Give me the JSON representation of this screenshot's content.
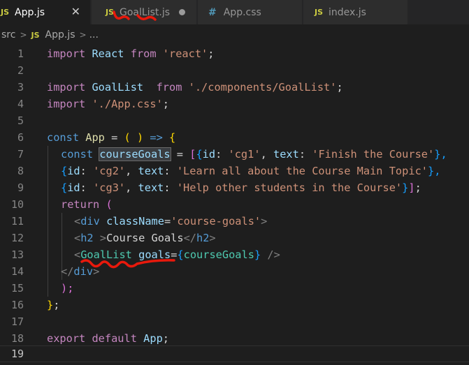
{
  "tabs": [
    {
      "icon": "JS",
      "label": "App.js",
      "close": "✕"
    },
    {
      "icon": "JS",
      "label": "GoalList.js"
    },
    {
      "icon": "#",
      "label": "App.css"
    },
    {
      "icon": "JS",
      "label": "index.js"
    }
  ],
  "breadcrumb": {
    "folder": "src",
    "sep": ">",
    "icon": "JS",
    "file": "App.js",
    "more": "..."
  },
  "editor": {
    "line_numbers": [
      "1",
      "2",
      "3",
      "4",
      "5",
      "6",
      "7",
      "8",
      "9",
      "10",
      "11",
      "12",
      "13",
      "14",
      "15",
      "16",
      "17",
      "18",
      "19"
    ],
    "line1": {
      "a": "import ",
      "b": "React",
      "c": " from ",
      "d": "'react'",
      "e": ";"
    },
    "line3": {
      "a": "import ",
      "b": "GoalList",
      "c": "  from ",
      "d": "'./components/GoalList'",
      "e": ";"
    },
    "line4": {
      "a": "import ",
      "b": "'./App.css'",
      "c": ";"
    },
    "line6": {
      "a": "const ",
      "b": "App",
      "c": " = ",
      "d": "(",
      "e": " ",
      "f": ")",
      "g": " => ",
      "h": "{"
    },
    "line7": {
      "a": "const ",
      "b": "courseGoals",
      "c": " = ",
      "d": "[",
      "e": "{",
      "f": "id",
      "g": ": ",
      "h": "'cg1'",
      "i": ", ",
      "j": "text",
      "k": ": ",
      "l": "'Finish the Course'",
      "m": "},"
    },
    "line8": {
      "a": "{",
      "b": "id",
      "c": ": ",
      "d": "'cg2'",
      "e": ", ",
      "f": "text",
      "g": ": ",
      "h": "'Learn all about the Course Main Topic'",
      "i": "},"
    },
    "line9": {
      "a": "{",
      "b": "id",
      "c": ": ",
      "d": "'cg3'",
      "e": ", ",
      "f": "text",
      "g": ": ",
      "h": "'Help other students in the Course'",
      "i": "}",
      "j": "]",
      "k": ";"
    },
    "line10": {
      "a": "return ",
      "b": "("
    },
    "line11": {
      "a": "<",
      "b": "div",
      "c": " ",
      "d": "className",
      "e": "=",
      "f": "'course-goals'",
      "g": ">"
    },
    "line12": {
      "a": "<",
      "b": "h2",
      "c": " >",
      "d": "Course Goals",
      "e": "</",
      "f": "h2",
      "g": ">"
    },
    "line13": {
      "a": "<",
      "b": "GoalList",
      "c": " ",
      "d": "goals",
      "e": "=",
      "f": "{",
      "g": "courseGoals",
      "h": "}",
      "i": " />"
    },
    "line14": {
      "a": "</",
      "b": "div",
      "c": ">"
    },
    "line15": {
      "a": ");"
    },
    "line16": {
      "a": "}",
      "b": ";"
    },
    "line18": {
      "a": "export ",
      "b": "default ",
      "c": "App",
      "d": ";"
    }
  },
  "colors": {
    "annotation": "#e8190c",
    "modified_dot": "#9a9a9a"
  }
}
